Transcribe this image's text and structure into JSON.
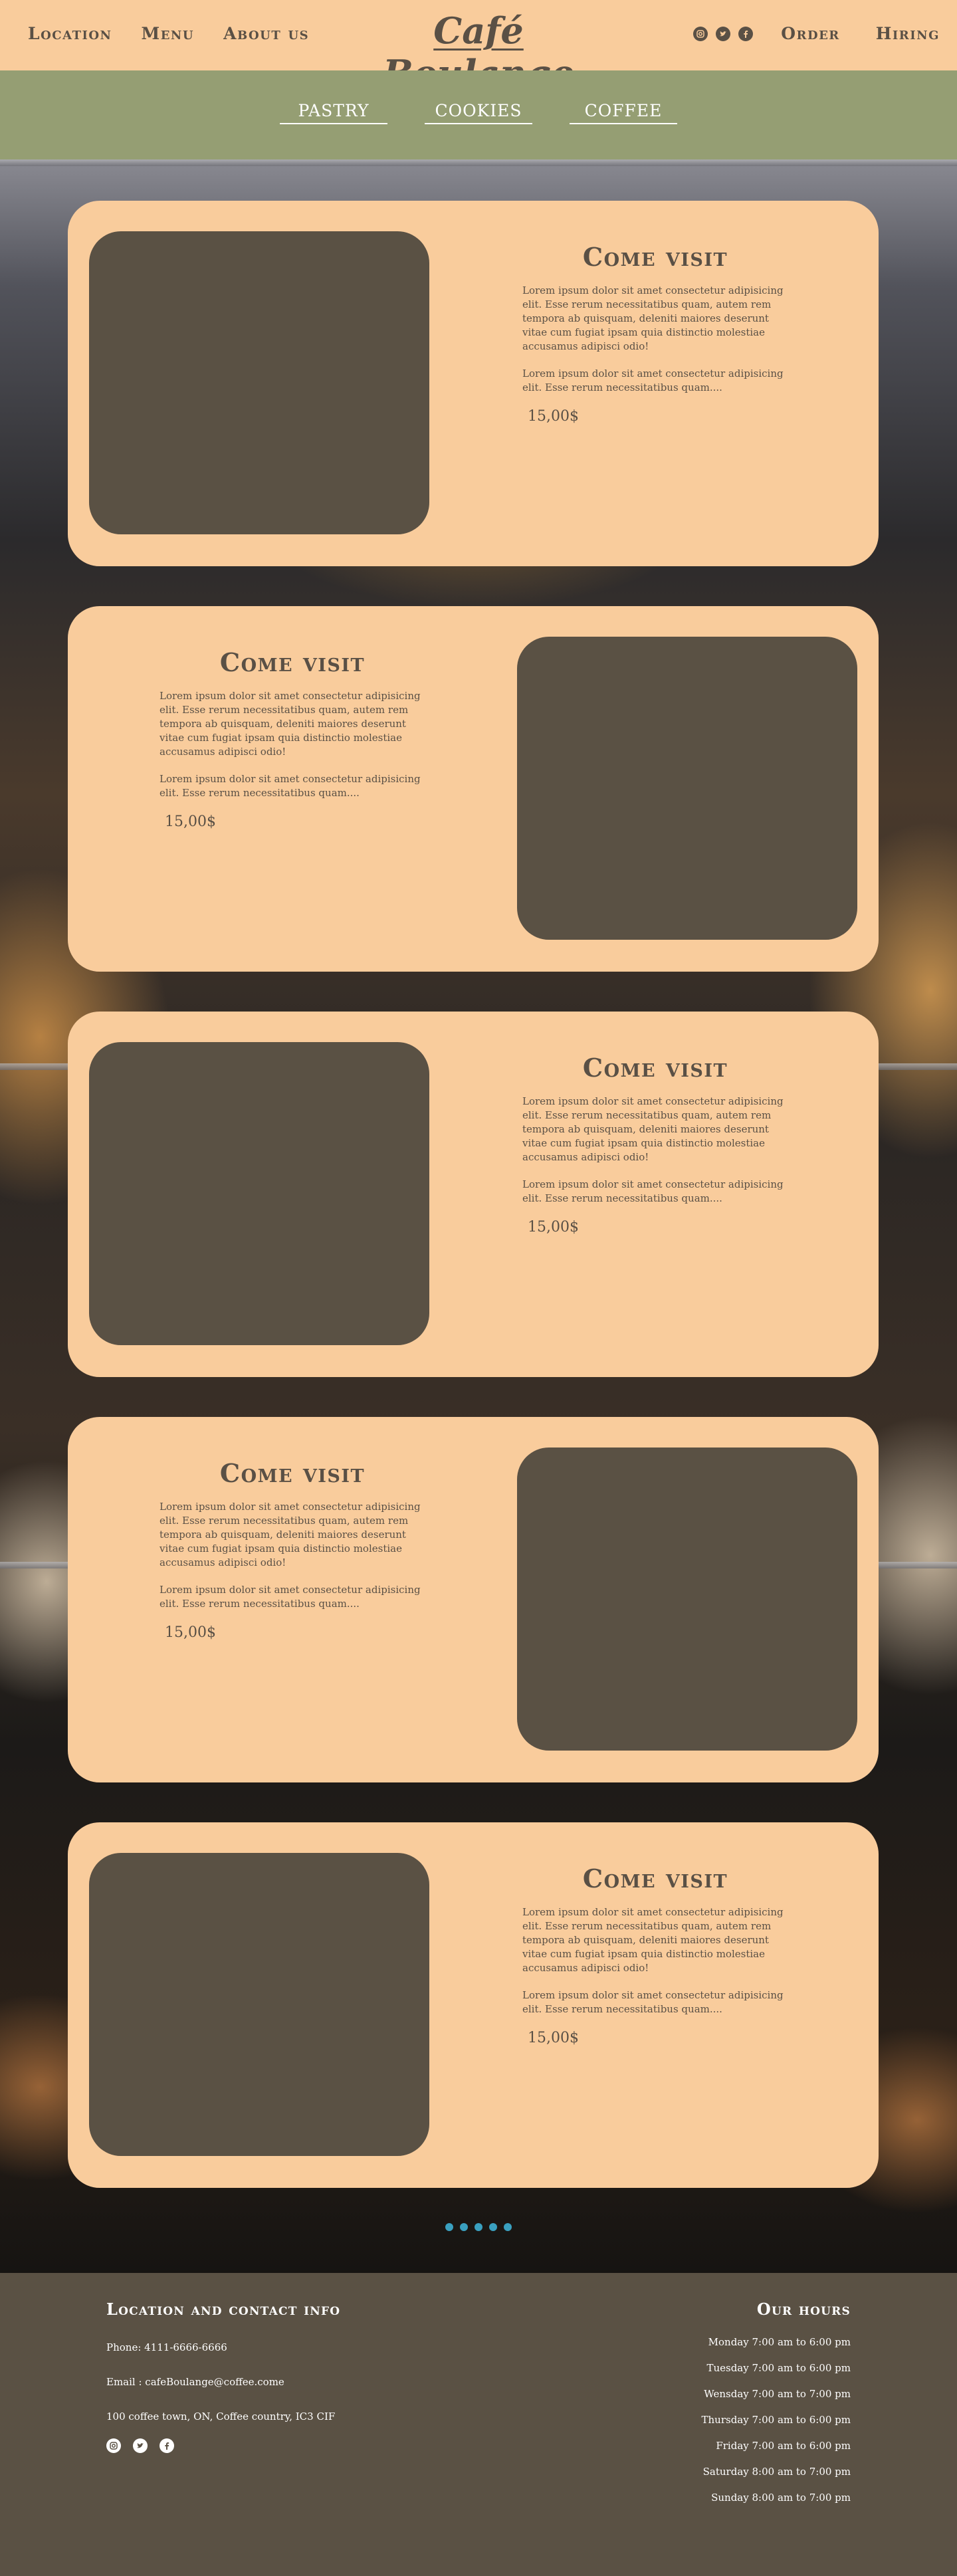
{
  "header": {
    "brand": "Café Boulange",
    "nav_left": [
      "Location",
      "Menu",
      "About us"
    ],
    "nav_right": [
      "Order",
      "Hiring"
    ],
    "social_icons": [
      "instagram-icon",
      "twitter-icon",
      "facebook-icon"
    ]
  },
  "categories": [
    "PASTRY",
    "COOKIES",
    "COFFEE"
  ],
  "cards": [
    {
      "title": "Come visit",
      "p1": "Lorem ipsum dolor sit amet consectetur adipisicing elit. Esse rerum necessitatibus quam, autem rem tempora ab quisquam, deleniti maiores deserunt vitae cum fugiat ipsam quia distinctio molestiae accusamus adipisci odio!",
      "p2": "Lorem ipsum dolor sit amet consectetur adipisicing elit. Esse rerum necessitatibus quam....",
      "price": "15,00$"
    },
    {
      "title": "Come visit",
      "p1": "Lorem ipsum dolor sit amet consectetur adipisicing elit. Esse rerum necessitatibus quam, autem rem tempora ab quisquam, deleniti maiores deserunt vitae cum fugiat ipsam quia distinctio molestiae accusamus adipisci odio!",
      "p2": "Lorem ipsum dolor sit amet consectetur adipisicing elit. Esse rerum necessitatibus quam....",
      "price": "15,00$"
    },
    {
      "title": "Come visit",
      "p1": "Lorem ipsum dolor sit amet consectetur adipisicing elit. Esse rerum necessitatibus quam, autem rem tempora ab quisquam, deleniti maiores deserunt vitae cum fugiat ipsam quia distinctio molestiae accusamus adipisci odio!",
      "p2": "Lorem ipsum dolor sit amet consectetur adipisicing elit. Esse rerum necessitatibus quam....",
      "price": "15,00$"
    },
    {
      "title": "Come visit",
      "p1": "Lorem ipsum dolor sit amet consectetur adipisicing elit. Esse rerum necessitatibus quam, autem rem tempora ab quisquam, deleniti maiores deserunt vitae cum fugiat ipsam quia distinctio molestiae accusamus adipisci odio!",
      "p2": "Lorem ipsum dolor sit amet consectetur adipisicing elit. Esse rerum necessitatibus quam....",
      "price": "15,00$"
    },
    {
      "title": "Come visit",
      "p1": "Lorem ipsum dolor sit amet consectetur adipisicing elit. Esse rerum necessitatibus quam, autem rem tempora ab quisquam, deleniti maiores deserunt vitae cum fugiat ipsam quia distinctio molestiae accusamus adipisci odio!",
      "p2": "Lorem ipsum dolor sit amet consectetur adipisicing elit. Esse rerum necessitatibus quam....",
      "price": "15,00$"
    }
  ],
  "carousel": {
    "dot_count": 5,
    "dot_color": "#3aa0c0"
  },
  "footer": {
    "contact_title": "Location and contact info",
    "phone": "Phone: 4111-6666-6666",
    "email": "Email :  cafeBoulange@coffee.come",
    "address": "100 coffee town, ON, Coffee country, IC3 CIF",
    "hours_title": "Our hours",
    "hours": [
      "Monday 7:00 am to  6:00 pm",
      "Tuesday 7:00 am to  6:00 pm",
      "Wensday 7:00 am to  7:00 pm",
      "Thursday  7:00 am to  6:00 pm",
      "Friday  7:00 am to  6:00 pm",
      "Saturday  8:00 am to  7:00 pm",
      "Sunday 8:00 am to  7:00 pm"
    ]
  },
  "colors": {
    "peach": "#f9cc9c",
    "olive": "#959e73",
    "dark_brown": "#5a5144",
    "text_brown": "#5a5045"
  }
}
